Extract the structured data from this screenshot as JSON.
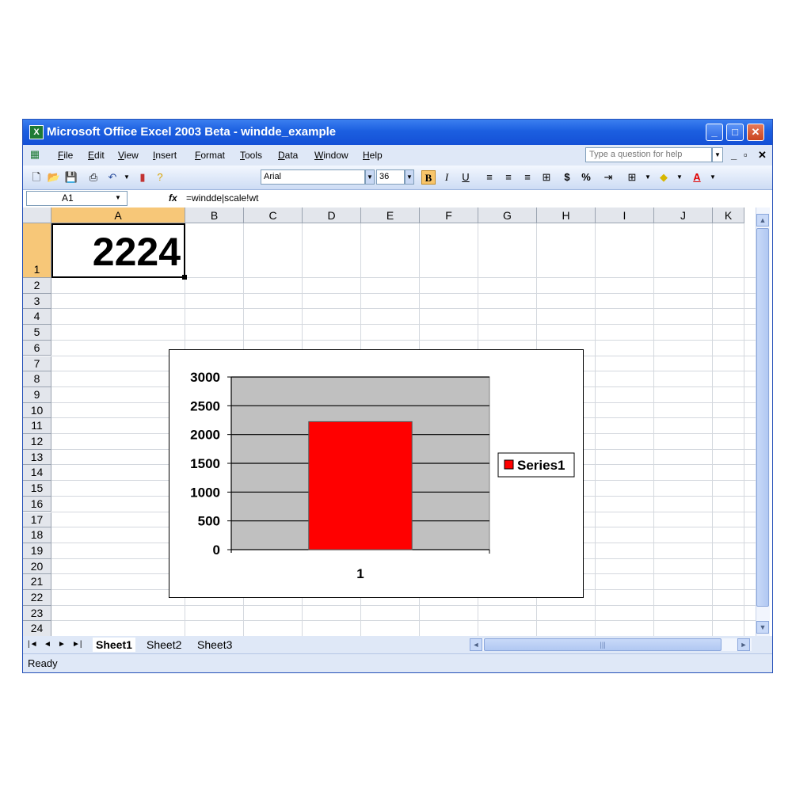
{
  "window": {
    "title": "Microsoft Office Excel 2003 Beta - windde_example",
    "app_icon": "excel-icon"
  },
  "menu": {
    "items": [
      "File",
      "Edit",
      "View",
      "Insert",
      "Format",
      "Tools",
      "Data",
      "Window",
      "Help"
    ],
    "ask_placeholder": "Type a question for help"
  },
  "toolbar": {
    "font_name": "Arial",
    "font_size": "36",
    "bold": "B",
    "italic": "I",
    "underline": "U",
    "currency": "$",
    "percent": "%"
  },
  "formula_bar": {
    "cell_ref": "A1",
    "fx": "fx",
    "formula": "=windde|scale!wt"
  },
  "grid": {
    "columns": [
      "A",
      "B",
      "C",
      "D",
      "E",
      "F",
      "G",
      "H",
      "I",
      "J",
      "K"
    ],
    "rows": [
      "1",
      "2",
      "3",
      "4",
      "5",
      "6",
      "7",
      "8",
      "9",
      "10",
      "11",
      "12",
      "13",
      "14",
      "15",
      "16",
      "17",
      "18",
      "19",
      "20",
      "21",
      "22",
      "23",
      "24"
    ],
    "a1_value": "2224"
  },
  "chart_data": {
    "type": "bar",
    "categories": [
      "1"
    ],
    "series": [
      {
        "name": "Series1",
        "values": [
          2224
        ],
        "color": "#ff0000"
      }
    ],
    "yticks": [
      "0",
      "500",
      "1000",
      "1500",
      "2000",
      "2500",
      "3000"
    ],
    "ylim": [
      0,
      3000
    ],
    "plot_background": "#c0c0c0",
    "grid": true,
    "legend": "right"
  },
  "sheets": {
    "tabs": [
      "Sheet1",
      "Sheet2",
      "Sheet3"
    ],
    "active": "Sheet1"
  },
  "status": {
    "text": "Ready"
  }
}
